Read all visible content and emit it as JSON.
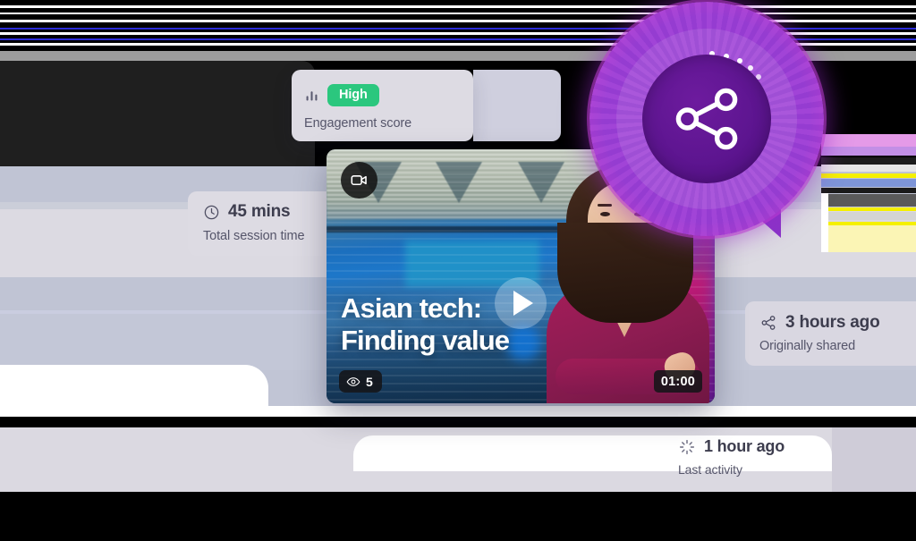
{
  "engagement_card": {
    "icon": "bar-chart-icon",
    "badge_label": "High",
    "badge_color": "#2bc77e",
    "caption": "Engagement score"
  },
  "session_card": {
    "icon": "clock-icon",
    "value": "45 mins",
    "caption": "Total session time"
  },
  "shared_card": {
    "icon": "share-icon",
    "value": "3 hours ago",
    "caption": "Originally shared"
  },
  "activity_card": {
    "icon": "sparkle-icon",
    "value": "1 hour ago",
    "caption": "Last activity"
  },
  "video_card": {
    "type_icon": "video-camera-icon",
    "play_icon": "play-icon",
    "title_line_1": "Asian tech:",
    "title_line_2": "Finding value",
    "views_icon": "eye-icon",
    "views_count": "5",
    "duration": "01:00"
  },
  "share_badge": {
    "icon": "share-nodes-icon",
    "accent_color": "#9a3fd4",
    "core_color": "#5d1590",
    "dot_count": 5
  },
  "colors": {
    "card_bg": "#dddbe3",
    "band_light": "#dcdae2",
    "band_mid": "#c0c4d4",
    "text_primary": "#3d3d4e",
    "text_secondary": "#55556a"
  }
}
